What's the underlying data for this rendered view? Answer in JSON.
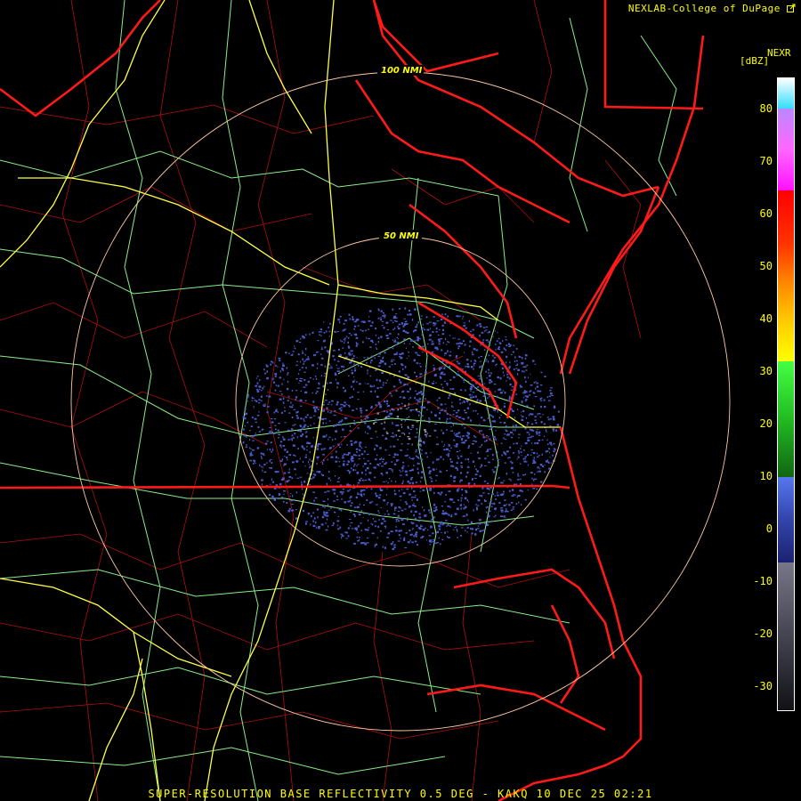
{
  "credit": "NEXLAB-College of DuPage",
  "footer": "SUPER-RESOLUTION BASE REFLECTIVITY 0.5 DEG - KAKQ 10 DEC 25 02:21",
  "legend": {
    "product": "NEXR",
    "unit": "[dBZ]",
    "ticks": [
      "80",
      "70",
      "60",
      "50",
      "40",
      "30",
      "20",
      "10",
      "0",
      "-10",
      "-20",
      "-30"
    ]
  },
  "range_rings": [
    {
      "label": "50 NMI"
    },
    {
      "label": "100 NMI"
    }
  ],
  "colors": {
    "background": "#000000",
    "state_borders": "#ff1a1a",
    "county_lines": "#cc1111",
    "interstates": "#ffff44",
    "highways": "#88ee88",
    "range_rings": "#ffc8a0",
    "echo": "#4a5ccc",
    "text": "#ffff00"
  },
  "icons": {
    "external_link": "external-link-icon"
  }
}
